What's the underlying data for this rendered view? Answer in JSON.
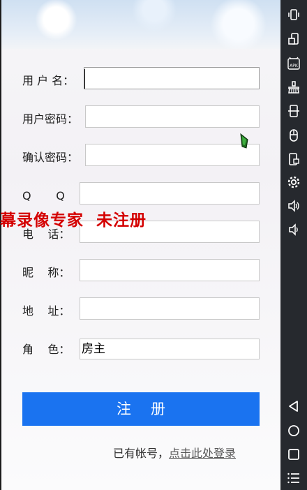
{
  "form": {
    "username_label": "用 户 名：",
    "password_label": "用户密码：",
    "confirm_label": "确认密码：",
    "qq_label": "Q       Q",
    "phone_label": "电    话：",
    "nickname_label": "昵    称：",
    "address_label": "地    址：",
    "role_label": "角    色：",
    "role_value": "房主"
  },
  "watermark": "幕录像专家  未注册",
  "register_button": "注册",
  "login_prompt": "已有帐号，",
  "login_link": "点击此处登录",
  "colors": {
    "accent": "#1a73f0",
    "watermark": "#d40000",
    "navbar": "#26292e"
  },
  "navbar_icons": [
    "vibrate-icon",
    "rotate-icon",
    "apk-icon",
    "clean-icon",
    "screenshot-icon",
    "mouse-icon",
    "record-icon",
    "settings-icon",
    "volume-up-icon",
    "volume-down-icon",
    "back-icon",
    "home-icon",
    "recents-icon",
    "menu-icon"
  ]
}
